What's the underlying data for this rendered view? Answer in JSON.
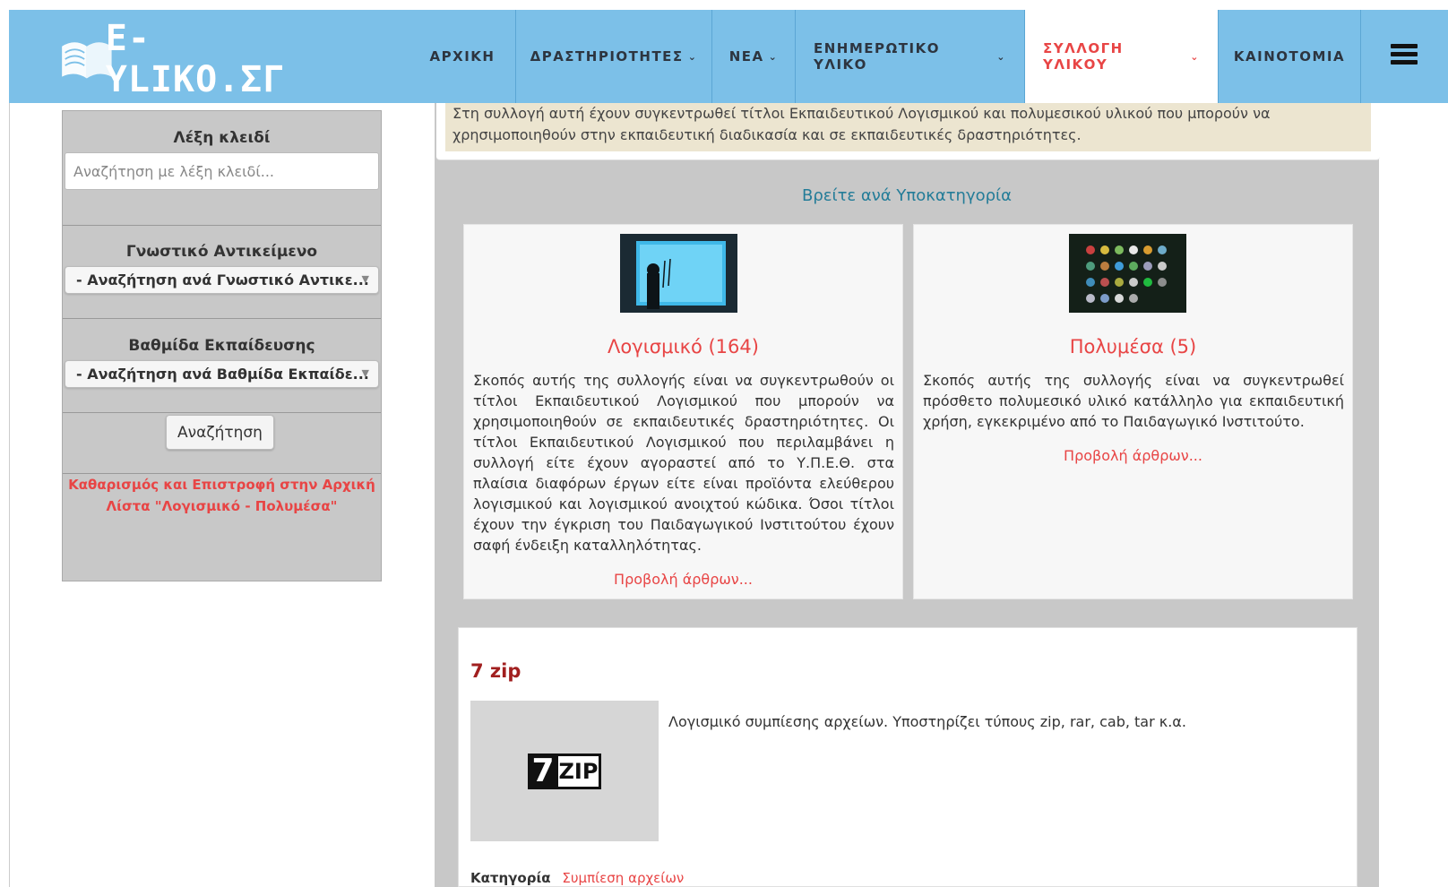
{
  "brand": {
    "logo_text": "E-YLIKO.ΣΓ",
    "colors": {
      "navbar": "#7cc0e8",
      "accent": "#e84545",
      "panel": "#c8c8c8"
    }
  },
  "nav": {
    "items": [
      {
        "label": "ΑΡΧΙΚΗ",
        "dropdown": false,
        "active": false
      },
      {
        "label": "ΔΡΑΣΤΗΡΙΟΤΗΤΕΣ",
        "dropdown": true,
        "active": false
      },
      {
        "label": "ΝΕΑ",
        "dropdown": true,
        "active": false
      },
      {
        "label": "ΕΝΗΜΕΡΩΤΙΚΟ ΥΛΙΚΟ",
        "dropdown": true,
        "active": false
      },
      {
        "label": "ΣΥΛΛΟΓΗ ΥΛΙΚΟΥ",
        "dropdown": true,
        "active": true
      },
      {
        "label": "ΚΑΙΝΟΤΟΜΙΑ",
        "dropdown": false,
        "active": false
      }
    ],
    "chevron": "⌄",
    "menu_icon": "hamburger-icon"
  },
  "sidebar": {
    "keyword_label": "Λέξη κλειδί",
    "keyword_placeholder": "Αναζήτηση με λέξη κλειδί...",
    "subject_label": "Γνωστικό Αντικείμενο",
    "subject_selected": "- Αναζήτηση ανά Γνωστικό Αντικε...",
    "level_label": "Βαθμίδα Εκπαίδευσης",
    "level_selected": "- Αναζήτηση ανά Βαθμίδα Εκπαίδε...",
    "search_button": "Αναζήτηση",
    "reset_link": "Καθαρισμός και Επιστροφή στην Αρχική Λίστα \"Λογισμικό - Πολυμέσα\""
  },
  "main": {
    "intro": "Στη συλλογή αυτή έχουν συγκεντρωθεί τίτλοι Εκπαιδευτικού Λογισμικού και πολυμεσικού υλικού που μπορούν να χρησιμοποιηθούν στην εκπαιδευτική διαδικασία και σε εκπαιδευτικές δραστηριότητες.",
    "subcategory_heading": "Βρείτε ανά Υποκατηγορία",
    "cards": [
      {
        "title": "Λογισμικό (164)",
        "body": "Σκοπός αυτής της συλλογής είναι να συγκεντρωθούν οι τίτλοι Εκπαιδευτικού Λογισμικού που μπορούν να χρησιμοποιηθούν σε εκπαιδευτικές δραστηριότητες. Οι τίτλοι Εκπαιδευτικού Λογισμικού που περιλαμβάνει η συλλογή είτε έχουν αγοραστεί από το Υ.Π.Ε.Θ. στα πλαίσια διαφόρων έργων είτε είναι προϊόντα ελεύθερου λογισμικού και λογισμικού ανοιχτού κώδικα. Όσοι τίτλοι έχουν την έγκριση του Παιδαγωγικού Ινστιτούτου έχουν σαφή ένδειξη καταλληλότητας.",
        "link": "Προβολή άρθρων..."
      },
      {
        "title": "Πολυμέσα (5)",
        "body": "Σκοπός αυτής της συλλογής είναι να συγκεντρωθεί πρόσθετο πολυμεσικό υλικό κατάλληλο για εκπαιδευτική χρήση, εγκεκριμένο από το Παιδαγωγικό Ινστιτούτο.",
        "link": "Προβολή άρθρων..."
      }
    ],
    "article": {
      "title": "7 zip",
      "logo_seven": "7",
      "logo_text": "ZIP",
      "description": "Λογισμικό συμπίεσης αρχείων. Υποστηρίζει τύπους zip, rar, cab, tar κ.α.",
      "category_label": "Κατηγορία",
      "category_value": "Συμπίεση αρχείων"
    }
  }
}
